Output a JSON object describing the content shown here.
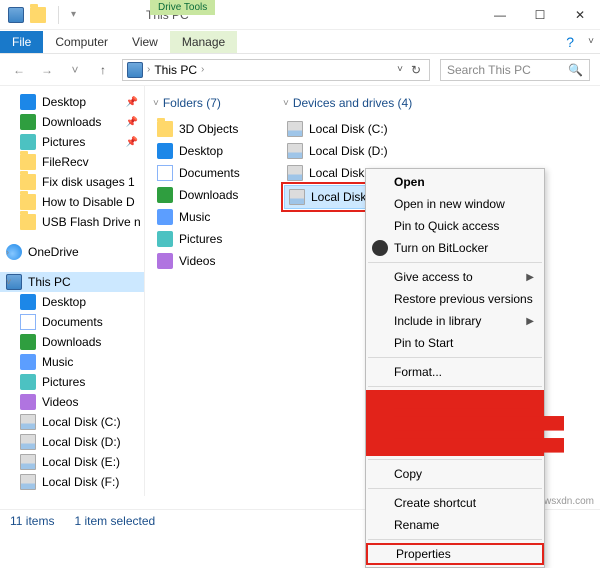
{
  "window": {
    "title": "This PC",
    "drivetools_label": "Drive Tools",
    "drivetools_tab": "Manage",
    "controls": {
      "min": "—",
      "max": "☐",
      "close": "✕"
    }
  },
  "ribbon": {
    "file": "File",
    "tabs": [
      "Computer",
      "View"
    ],
    "help": "?",
    "expand": "˅"
  },
  "address": {
    "back": "←",
    "forward": "→",
    "dropdown": "˅",
    "up": "↑",
    "crumb": "This PC",
    "chev": "›",
    "refresh": "↻"
  },
  "search": {
    "placeholder": "Search This PC"
  },
  "sidebar": {
    "quickaccess": [
      {
        "label": "Desktop",
        "icon": "desktop",
        "pin": true
      },
      {
        "label": "Downloads",
        "icon": "download",
        "pin": true
      },
      {
        "label": "Pictures",
        "icon": "picture",
        "pin": true
      },
      {
        "label": "FileRecv",
        "icon": "folder",
        "pin": false
      },
      {
        "label": "Fix disk usages 1",
        "icon": "folder",
        "pin": false
      },
      {
        "label": "How to Disable D",
        "icon": "folder",
        "pin": false
      },
      {
        "label": "USB Flash Drive n",
        "icon": "folder",
        "pin": false
      }
    ],
    "onedrive": {
      "label": "OneDrive"
    },
    "thispc": {
      "label": "This PC"
    },
    "pcchildren": [
      {
        "label": "Desktop",
        "icon": "desktop"
      },
      {
        "label": "Documents",
        "icon": "docs"
      },
      {
        "label": "Downloads",
        "icon": "download"
      },
      {
        "label": "Music",
        "icon": "music"
      },
      {
        "label": "Pictures",
        "icon": "picture"
      },
      {
        "label": "Videos",
        "icon": "video"
      },
      {
        "label": "Local Disk (C:)",
        "icon": "drive"
      },
      {
        "label": "Local Disk (D:)",
        "icon": "drive"
      },
      {
        "label": "Local Disk (E:)",
        "icon": "drive"
      },
      {
        "label": "Local Disk (F:)",
        "icon": "drive"
      }
    ]
  },
  "content": {
    "folders": {
      "title": "Folders (7)",
      "items": [
        {
          "label": "3D Objects",
          "icon": "folder"
        },
        {
          "label": "Desktop",
          "icon": "desktop"
        },
        {
          "label": "Documents",
          "icon": "docs"
        },
        {
          "label": "Downloads",
          "icon": "download"
        },
        {
          "label": "Music",
          "icon": "music"
        },
        {
          "label": "Pictures",
          "icon": "picture"
        },
        {
          "label": "Videos",
          "icon": "video"
        }
      ]
    },
    "drives": {
      "title": "Devices and drives (4)",
      "items": [
        {
          "label": "Local Disk (C:)"
        },
        {
          "label": "Local Disk (D:)"
        },
        {
          "label": "Local Disk (E:)"
        },
        {
          "label": "Local Disk (F:)"
        }
      ],
      "selected_index": 3
    }
  },
  "context_menu": {
    "items": [
      {
        "label": "Open",
        "bold": true
      },
      {
        "label": "Open in new window"
      },
      {
        "label": "Pin to Quick access"
      },
      {
        "label": "Turn on BitLocker",
        "icon": "bitlocker"
      },
      {
        "sep": true
      },
      {
        "label": "Give access to",
        "submenu": true
      },
      {
        "label": "Restore previous versions"
      },
      {
        "label": "Include in library",
        "submenu": true
      },
      {
        "label": "Pin to Start"
      },
      {
        "sep": true
      },
      {
        "label": "Format..."
      },
      {
        "sep": true
      },
      {
        "label": "████████████████",
        "redacted": true
      },
      {
        "label": "████████████████████",
        "redacted": true
      },
      {
        "label": "████████████████████",
        "redacted": true
      },
      {
        "sep": true
      },
      {
        "label": "Copy"
      },
      {
        "sep": true
      },
      {
        "label": "Create shortcut"
      },
      {
        "label": "Rename"
      },
      {
        "sep": true
      },
      {
        "label": "Properties",
        "highlighted": true
      }
    ]
  },
  "status": {
    "items_count": "11 items",
    "selected": "1 item selected"
  },
  "watermark": "wsxdn.com"
}
